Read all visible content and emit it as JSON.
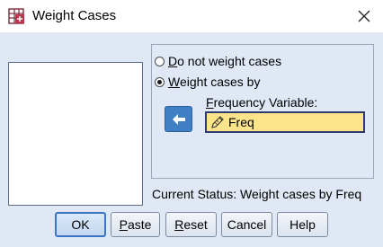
{
  "window": {
    "title": "Weight Cases",
    "icons": {
      "app": "spss-dataset-icon",
      "close": "close-icon"
    }
  },
  "options": {
    "no_weight_prefix": "D",
    "no_weight_rest": "o not weight cases",
    "weight_by_prefix": "W",
    "weight_by_rest": "eight cases by",
    "selected": "weight_by"
  },
  "frequency": {
    "label_prefix": "F",
    "label_rest": "requency Variable:",
    "value": "Freq",
    "field_color": "#fce48a"
  },
  "status": {
    "text": "Current Status: Weight cases by Freq"
  },
  "buttons": {
    "ok": "OK",
    "paste_prefix": "P",
    "paste_rest": "aste",
    "reset_prefix": "R",
    "reset_rest": "eset",
    "cancel": "Cancel",
    "help": "Help"
  },
  "colors": {
    "accent": "#3f7fc4",
    "background": "#dfe8f4"
  }
}
